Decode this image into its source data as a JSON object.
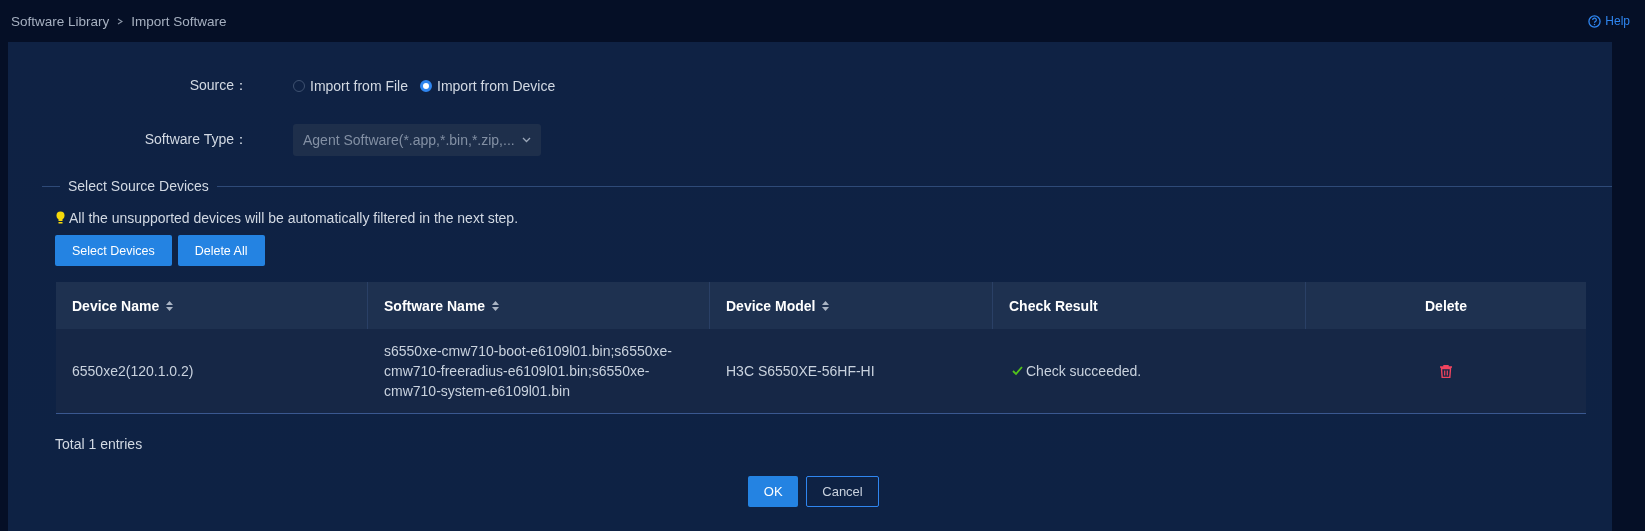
{
  "breadcrumb": [
    "Software Library",
    "Import Software"
  ],
  "help": {
    "label": "Help"
  },
  "form": {
    "source": {
      "label": "Source：",
      "options": [
        {
          "label": "Import from File",
          "selected": false
        },
        {
          "label": "Import from Device",
          "selected": true
        }
      ]
    },
    "software_type": {
      "label": "Software Type：",
      "value": "Agent Software(*.app,*.bin,*.zip,...",
      "disabled": true
    }
  },
  "section": {
    "title": "Select Source Devices",
    "tip": "All the unsupported devices will be automatically filtered in the next step."
  },
  "actions": [
    "Select Devices",
    "Delete All"
  ],
  "table": {
    "columns": [
      {
        "label": "Device Name",
        "sortable": true
      },
      {
        "label": "Software Name",
        "sortable": true
      },
      {
        "label": "Device Model",
        "sortable": true
      },
      {
        "label": "Check Result",
        "sortable": false
      },
      {
        "label": "Delete",
        "sortable": false
      }
    ],
    "rows": [
      {
        "device_name": "6550xe2(120.1.0.2)",
        "software_name": "s6550xe-cmw710-boot-e6109l01.bin;s6550xe-cmw710-freeradius-e6109l01.bin;s6550xe-cmw710-system-e6109l01.bin",
        "device_model": "H3C S6550XE-56HF-HI",
        "check_result": {
          "kind": "success",
          "text": "Check succeeded."
        }
      }
    ]
  },
  "total": "Total 1 entries",
  "footer_buttons": [
    {
      "label": "OK",
      "kind": "primary"
    },
    {
      "label": "Cancel",
      "kind": "secondary"
    }
  ]
}
